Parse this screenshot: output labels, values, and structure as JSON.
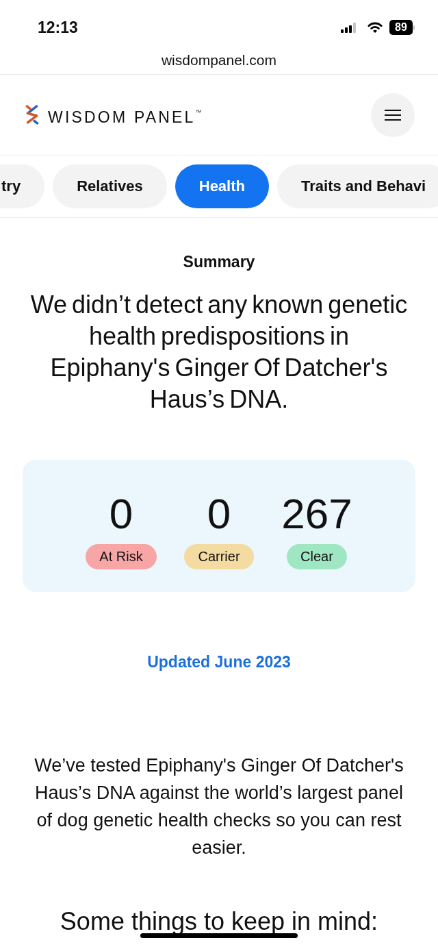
{
  "status_bar": {
    "time": "12:13",
    "battery": "89"
  },
  "browser": {
    "url": "wisdompanel.com"
  },
  "header": {
    "logo": "WISDOM PANEL$^{™}$"
  },
  "tabs": [
    {
      "label": "try",
      "selected": false
    },
    {
      "label": "Relatives",
      "selected": false
    },
    {
      "label": "Health",
      "selected": true
    },
    {
      "label": "Traits and Behavi",
      "selected": false
    }
  ],
  "summary": {
    "title": "Summary",
    "headline": "We didn’t detect any known genetic health predispositions in Epiphany's Ginger Of Datcher's Haus’s DNA.",
    "stats": [
      {
        "count": "0",
        "label": "At Risk",
        "color": "#f8a5a6"
      },
      {
        "count": "0",
        "label": "Carrier",
        "color": "#f3dba2"
      },
      {
        "count": "267",
        "label": "Clear",
        "color": "#9fe6c2"
      }
    ],
    "updated": "Updated June 2023",
    "body": "We’ve tested Epiphany's Ginger Of Datcher's Haus’s DNA against the world’s largest panel of dog genetic health checks so you can rest easier.",
    "section_title": "Some things to keep in mind:"
  }
}
